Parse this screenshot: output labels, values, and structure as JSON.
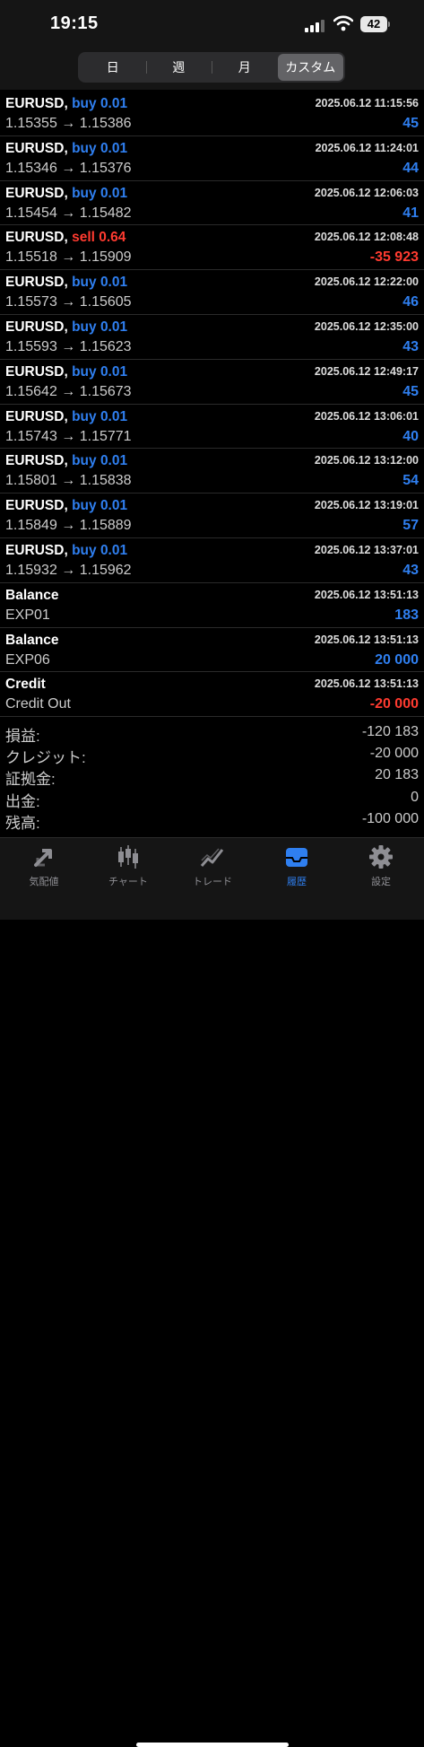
{
  "status_bar": {
    "time": "19:15",
    "battery": "42"
  },
  "period_tabs": [
    {
      "label": "日",
      "active": false
    },
    {
      "label": "週",
      "active": false
    },
    {
      "label": "月",
      "active": false
    },
    {
      "label": "カスタム",
      "active": true
    }
  ],
  "history": [
    {
      "symbol": "EURUSD,",
      "side": "buy 0.01",
      "type": "buy",
      "date": "2025.06.12 11:15:56",
      "prices": "1.15355 → 1.15386",
      "profit": "45",
      "sign": "pos"
    },
    {
      "symbol": "EURUSD,",
      "side": "buy 0.01",
      "type": "buy",
      "date": "2025.06.12 11:24:01",
      "prices": "1.15346 → 1.15376",
      "profit": "44",
      "sign": "pos"
    },
    {
      "symbol": "EURUSD,",
      "side": "buy 0.01",
      "type": "buy",
      "date": "2025.06.12 12:06:03",
      "prices": "1.15454 → 1.15482",
      "profit": "41",
      "sign": "pos"
    },
    {
      "symbol": "EURUSD,",
      "side": "sell 0.64",
      "type": "sell",
      "date": "2025.06.12 12:08:48",
      "prices": "1.15518 → 1.15909",
      "profit": "-35 923",
      "sign": "neg"
    },
    {
      "symbol": "EURUSD,",
      "side": "buy 0.01",
      "type": "buy",
      "date": "2025.06.12 12:22:00",
      "prices": "1.15573 → 1.15605",
      "profit": "46",
      "sign": "pos"
    },
    {
      "symbol": "EURUSD,",
      "side": "buy 0.01",
      "type": "buy",
      "date": "2025.06.12 12:35:00",
      "prices": "1.15593 → 1.15623",
      "profit": "43",
      "sign": "pos"
    },
    {
      "symbol": "EURUSD,",
      "side": "buy 0.01",
      "type": "buy",
      "date": "2025.06.12 12:49:17",
      "prices": "1.15642 → 1.15673",
      "profit": "45",
      "sign": "pos"
    },
    {
      "symbol": "EURUSD,",
      "side": "buy 0.01",
      "type": "buy",
      "date": "2025.06.12 13:06:01",
      "prices": "1.15743 → 1.15771",
      "profit": "40",
      "sign": "pos"
    },
    {
      "symbol": "EURUSD,",
      "side": "buy 0.01",
      "type": "buy",
      "date": "2025.06.12 13:12:00",
      "prices": "1.15801 → 1.15838",
      "profit": "54",
      "sign": "pos"
    },
    {
      "symbol": "EURUSD,",
      "side": "buy 0.01",
      "type": "buy",
      "date": "2025.06.12 13:19:01",
      "prices": "1.15849 → 1.15889",
      "profit": "57",
      "sign": "pos"
    },
    {
      "symbol": "EURUSD,",
      "side": "buy 0.01",
      "type": "buy",
      "date": "2025.06.12 13:37:01",
      "prices": "1.15932 → 1.15962",
      "profit": "43",
      "sign": "pos"
    },
    {
      "symbol": "Balance",
      "side": "",
      "type": "buy",
      "date": "2025.06.12 13:51:13",
      "prices": "EXP01",
      "profit": "183",
      "sign": "pos"
    },
    {
      "symbol": "Balance",
      "side": "",
      "type": "buy",
      "date": "2025.06.12 13:51:13",
      "prices": "EXP06",
      "profit": "20 000",
      "sign": "pos"
    },
    {
      "symbol": "Credit",
      "side": "",
      "type": "buy",
      "date": "2025.06.12 13:51:13",
      "prices": "Credit Out",
      "profit": "-20 000",
      "sign": "neg"
    }
  ],
  "summary": [
    {
      "label": "損益:",
      "value": "-120 183"
    },
    {
      "label": "クレジット:",
      "value": "-20 000"
    },
    {
      "label": "証拠金:",
      "value": "20 183"
    },
    {
      "label": "出金:",
      "value": "0"
    },
    {
      "label": "残高:",
      "value": "-100 000"
    }
  ],
  "tab_bar": [
    {
      "label": "気配値",
      "icon": "quotes-arrows-icon",
      "active": false
    },
    {
      "label": "チャート",
      "icon": "candlestick-chart-icon",
      "active": false
    },
    {
      "label": "トレード",
      "icon": "trade-line-icon",
      "active": false
    },
    {
      "label": "履歴",
      "icon": "history-inbox-icon",
      "active": true
    },
    {
      "label": "設定",
      "icon": "gear-icon",
      "active": false
    }
  ],
  "colors": {
    "buy": "#2f7ff0",
    "sell": "#ff3b30",
    "background": "#000000",
    "accent": "#2f7ff0"
  }
}
